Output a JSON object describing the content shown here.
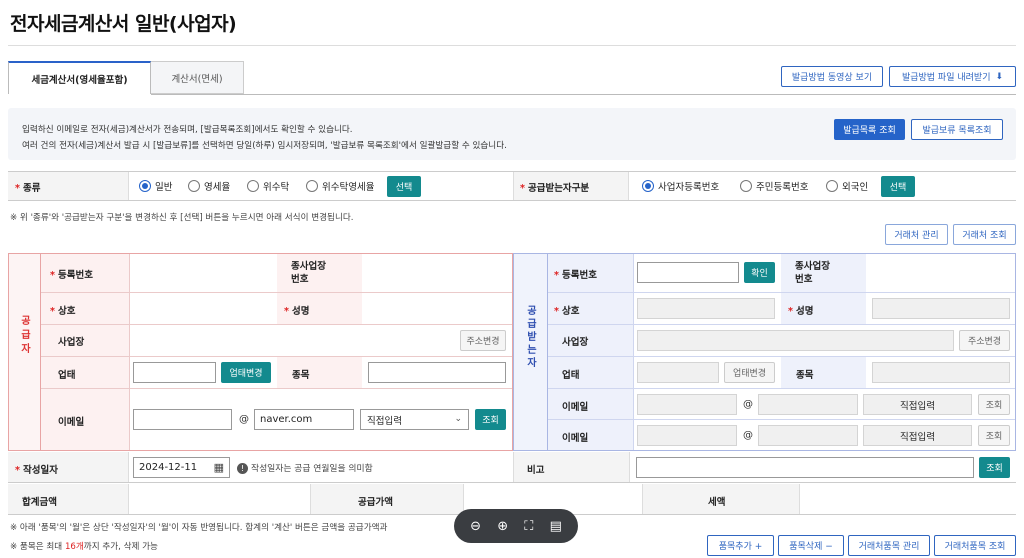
{
  "page": {
    "title": "전자세금계산서 일반(사업자)"
  },
  "tabs": [
    {
      "label": "세금계산서(영세율포함)"
    },
    {
      "label": "계산서(면세)"
    }
  ],
  "top_buttons": {
    "video": "발급방법 동영상 보기",
    "download": "발급방법 파일 내려받기"
  },
  "info": {
    "line1": "입력하신 이메일로 전자(세금)계산서가 전송되며, [발급목록조회]에서도 확인할 수 있습니다.",
    "line2": "여러 건의 전자(세금)계산서 발급 시 [발급보류]를 선택하면 당일(하루) 임시저장되며, '발급보류 목록조회'에서 일괄발급할 수 있습니다.",
    "btn_list": "발급목록 조회",
    "btn_hold": "발급보류 목록조회"
  },
  "type_row": {
    "label": "종류",
    "options": [
      "일반",
      "영세율",
      "위수탁",
      "위수탁영세율"
    ],
    "selected": "일반",
    "select": "선택",
    "receiver_label": "공급받는자구분",
    "receiver_options": [
      "사업자등록번호",
      "주민등록번호",
      "외국인"
    ],
    "receiver_selected": "사업자등록번호",
    "receiver_select": "선택"
  },
  "notes": {
    "n1": "※ 위 '종류'와 '공급받는자 구분'을 변경하신 후 [선택] 버튼을 누르시면 아래 서식이 변경됩니다.",
    "n2": "※ 아래 '품목'의 '월'은 상단 '작성일자'의 '월'이 자동 반영됩니다. 합계의 '계산' 버튼은 금액을 공급가액과",
    "n3_pre": "※ 품목은 최대 ",
    "n3_red": "16개",
    "n3_post": "까지 추가, 삭제 가능"
  },
  "partner_buttons": {
    "manage": "거래처 관리",
    "lookup": "거래처 조회"
  },
  "supplier": {
    "side": "공급자",
    "reg_no": "등록번호",
    "sub_no": "종사업장\n번호",
    "name": "상호",
    "rep": "성명",
    "addr": "사업장",
    "addr_btn": "주소변경",
    "biz_type": "업태",
    "biz_btn": "업태변경",
    "item": "종목",
    "email": "이메일",
    "email_domain": "naver.com",
    "email_sel": "직접입력",
    "email_btn": "조회"
  },
  "receiver": {
    "side": "공급받는자",
    "reg_no": "등록번호",
    "confirm": "확인",
    "sub_no": "종사업장\n번호",
    "name": "상호",
    "rep": "성명",
    "addr": "사업장",
    "addr_btn": "주소변경",
    "biz_type": "업태",
    "biz_btn": "업태변경",
    "item": "종목",
    "email": "이메일",
    "email_sel": "직접입력",
    "email_btn": "조회",
    "email2": "이메일",
    "email2_sel": "직접입력",
    "email2_btn": "조회"
  },
  "date_row": {
    "label": "작성일자",
    "value": "2024-12-11",
    "hint": "작성일자는 공급 연월일을 의미함",
    "memo": "비고",
    "memo_btn": "조회"
  },
  "sum_row": {
    "total": "합계금액",
    "supply": "공급가액",
    "tax": "세액"
  },
  "item_buttons": {
    "add": "품목추가 +",
    "del": "품목삭제 −",
    "partner_items": "거래처품목 관리",
    "partner_items_lookup": "거래처품목 조회"
  },
  "zoom": {
    "icons": [
      "zoom-out",
      "zoom-in",
      "fullscreen",
      "document"
    ]
  },
  "colors": {
    "accent": "#2563c9",
    "teal": "#138a8e",
    "supplier": "#e8a4a4",
    "receiver": "#a9b6e3"
  }
}
